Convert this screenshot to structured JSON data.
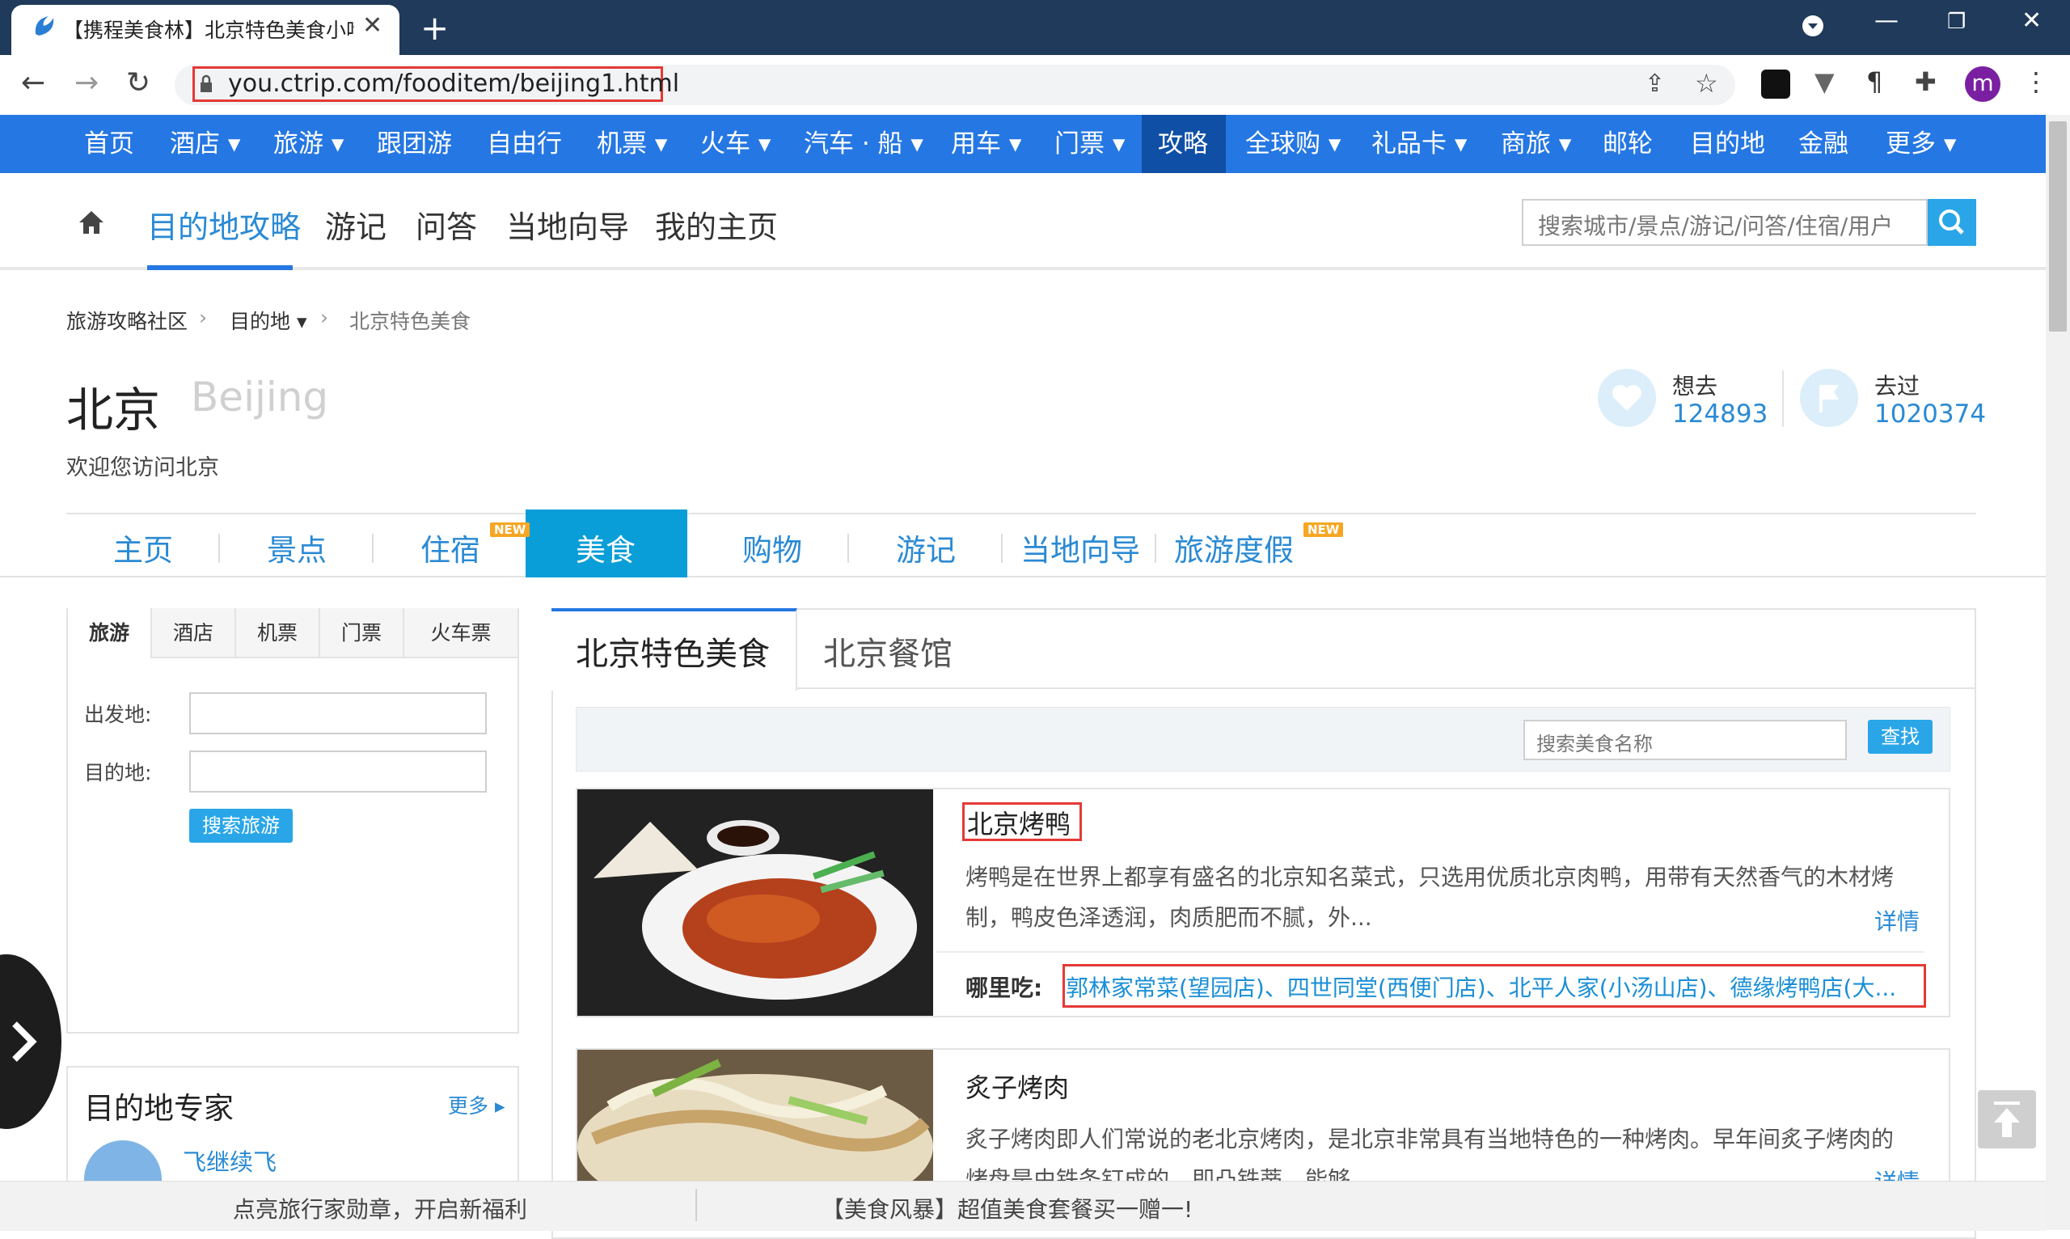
{
  "browser": {
    "tab_title": "【携程美食林】北京特色美食小吃",
    "url": "you.ctrip.com/fooditem/beijing1.html",
    "profile_initial": "m"
  },
  "topnav": {
    "items": [
      "首页",
      "酒店 ▾",
      "旅游 ▾",
      "跟团游",
      "自由行",
      "机票 ▾",
      "火车 ▾",
      "汽车 · 船 ▾",
      "用车 ▾",
      "门票 ▾",
      "攻略",
      "全球购 ▾",
      "礼品卡 ▾",
      "商旅 ▾",
      "邮轮",
      "目的地",
      "金融",
      "更多 ▾"
    ],
    "active": "攻略"
  },
  "secnav": {
    "items": [
      "目的地攻略",
      "游记",
      "问答",
      "当地向导",
      "我的主页"
    ],
    "search_placeholder": "搜索城市/景点/游记/问答/住宿/用户"
  },
  "breadcrumb": [
    "旅游攻略社区",
    "目的地 ▾",
    "北京特色美食"
  ],
  "city": {
    "name": "北京",
    "name_en": "Beijing",
    "welcome": "欢迎您访问北京",
    "want_label": "想去",
    "want_count": "124893",
    "been_label": "去过",
    "been_count": "1020374"
  },
  "city_tabs": {
    "items": [
      "主页",
      "景点",
      "住宿",
      "美食",
      "购物",
      "游记",
      "当地向导",
      "旅游度假"
    ],
    "active": "美食",
    "new_badge": "NEW"
  },
  "left_panel": {
    "tabs": [
      "旅游",
      "酒店",
      "机票",
      "门票",
      "火车票"
    ],
    "from_label": "出发地:",
    "to_label": "目的地:",
    "search_button": "搜索旅游"
  },
  "experts": {
    "title": "目的地专家",
    "more": "更多 ▸",
    "first_expert": "飞继续飞"
  },
  "main": {
    "tabs": [
      "北京特色美食",
      "北京餐馆"
    ],
    "search_placeholder": "搜索美食名称",
    "find_button": "查找",
    "where_label": "哪里吃:",
    "detail": "详情",
    "items": [
      {
        "title": "北京烤鸭",
        "desc": "烤鸭是在世界上都享有盛名的北京知名菜式，只选用优质北京肉鸭，用带有天然香气的木材烤制，鸭皮色泽透润，肉质肥而不腻，外...",
        "where": "郭林家常菜(望园店)、四世同堂(西便门店)、北平人家(小汤山店)、德缘烤鸭店(大..."
      },
      {
        "title": "炙子烤肉",
        "desc": "炙子烤肉即人们常说的老北京烤肉，是北京非常具有当地特色的一种烤肉。早年间炙子烤肉的烤盘是由铁条钉成的，即凸铁蒂，能够..."
      }
    ]
  },
  "bottom_bar": {
    "left": "点亮旅行家勋章，开启新福利",
    "right": "【美食风暴】超值美食套餐买一赠一!"
  },
  "colors": {
    "brand_blue": "#2577e3",
    "link_blue": "#2a8ad4",
    "highlight_red": "#e53935"
  }
}
